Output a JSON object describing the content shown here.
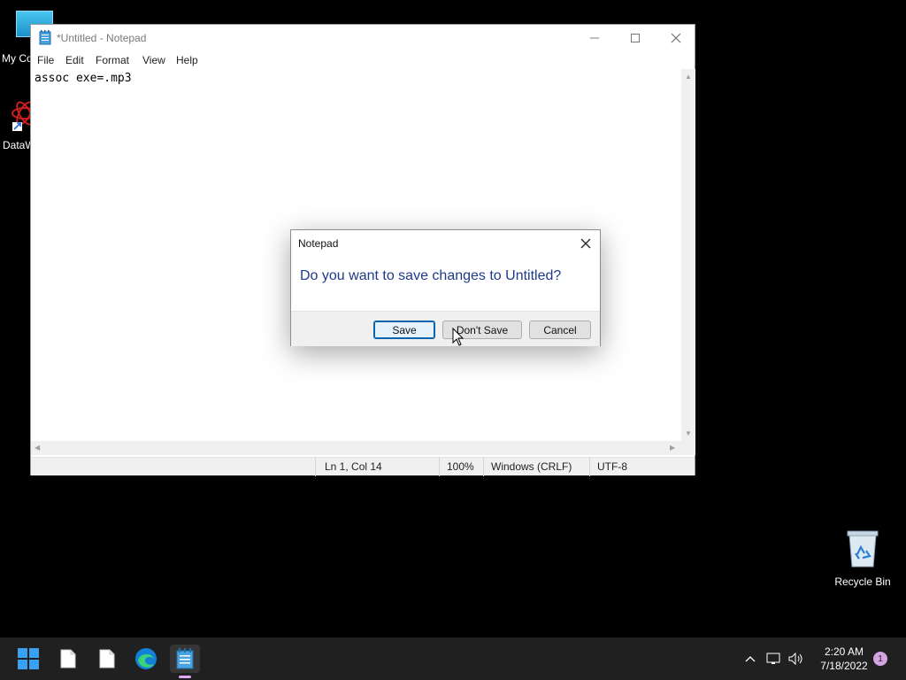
{
  "desktop": {
    "icons": [
      {
        "label": "My Co",
        "icon": "monitor-icon"
      },
      {
        "label": "DataW",
        "icon": "datawatch-icon"
      },
      {
        "label": "Recycle Bin",
        "icon": "recycle-bin-icon"
      }
    ]
  },
  "notepad": {
    "title": "*Untitled - Notepad",
    "menu": [
      "File",
      "Edit",
      "Format",
      "View",
      "Help"
    ],
    "content": "assoc exe=.mp3",
    "status": {
      "position": "Ln 1, Col 14",
      "zoom": "100%",
      "line_ending": "Windows (CRLF)",
      "encoding": "UTF-8"
    }
  },
  "dialog": {
    "title": "Notepad",
    "message": "Do you want to save changes to Untitled?",
    "buttons": {
      "save": "Save",
      "dont_save": "Don't Save",
      "cancel": "Cancel"
    }
  },
  "taskbar": {
    "clock_time": "2:20 AM",
    "clock_date": "7/18/2022",
    "notification_count": "1"
  },
  "colors": {
    "accent": "#0a64ad",
    "dialog_message": "#1e3a8a",
    "taskbar_bg": "#202020"
  }
}
